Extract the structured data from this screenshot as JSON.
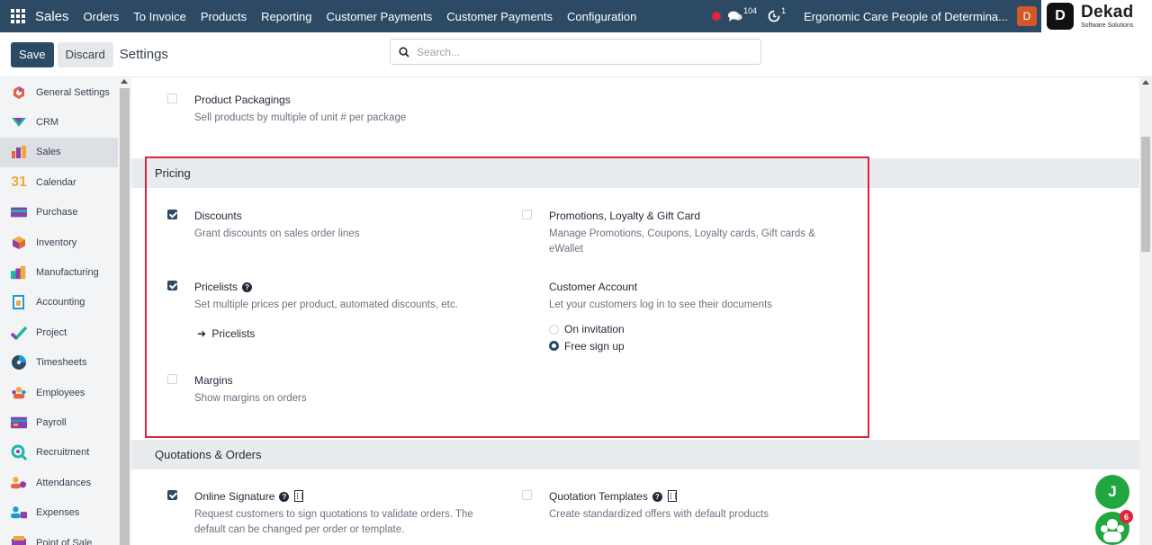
{
  "topbar": {
    "app_name": "Sales",
    "menu": [
      "Orders",
      "To Invoice",
      "Products",
      "Reporting",
      "Customer Payments",
      "Customer Payments",
      "Configuration"
    ],
    "messages_count": "104",
    "activities_count": "1",
    "company": "Ergonomic Care People of Determina...",
    "user_initial": "D",
    "brand_name": "Dekad",
    "brand_tagline": "Software Solutions",
    "brand_letter": "D"
  },
  "control_panel": {
    "save_label": "Save",
    "discard_label": "Discard",
    "title": "Settings",
    "search_placeholder": "Search..."
  },
  "sidebar": {
    "items": [
      {
        "label": "General Settings",
        "icon": "general-settings-icon"
      },
      {
        "label": "CRM",
        "icon": "crm-icon"
      },
      {
        "label": "Sales",
        "icon": "sales-icon",
        "active": true
      },
      {
        "label": "Calendar",
        "icon": "calendar-icon"
      },
      {
        "label": "Purchase",
        "icon": "purchase-icon"
      },
      {
        "label": "Inventory",
        "icon": "inventory-icon"
      },
      {
        "label": "Manufacturing",
        "icon": "manufacturing-icon"
      },
      {
        "label": "Accounting",
        "icon": "accounting-icon"
      },
      {
        "label": "Project",
        "icon": "project-icon"
      },
      {
        "label": "Timesheets",
        "icon": "timesheets-icon"
      },
      {
        "label": "Employees",
        "icon": "employees-icon"
      },
      {
        "label": "Payroll",
        "icon": "payroll-icon"
      },
      {
        "label": "Recruitment",
        "icon": "recruitment-icon"
      },
      {
        "label": "Attendances",
        "icon": "attendances-icon"
      },
      {
        "label": "Expenses",
        "icon": "expenses-icon"
      },
      {
        "label": "Point of Sale",
        "icon": "pos-icon"
      }
    ]
  },
  "settings": {
    "product_packagings": {
      "title": "Product Packagings",
      "desc": "Sell products by multiple of unit # per package",
      "checked": false
    },
    "pricing_section": "Pricing",
    "discounts": {
      "title": "Discounts",
      "desc": "Grant discounts on sales order lines",
      "checked": true
    },
    "promotions": {
      "title": "Promotions, Loyalty & Gift Card",
      "desc": "Manage Promotions, Coupons, Loyalty cards, Gift cards & eWallet",
      "checked": false
    },
    "pricelists": {
      "title": "Pricelists",
      "desc": "Set multiple prices per product, automated discounts, etc.",
      "checked": true,
      "link": "Pricelists"
    },
    "customer_account": {
      "title": "Customer Account",
      "desc": "Let your customers log in to see their documents",
      "options": [
        "On invitation",
        "Free sign up"
      ],
      "selected": "Free sign up"
    },
    "margins": {
      "title": "Margins",
      "desc": "Show margins on orders",
      "checked": false
    },
    "quotations_section": "Quotations & Orders",
    "online_signature": {
      "title": "Online Signature",
      "desc": "Request customers to sign quotations to validate orders. The default can be changed per order or template.",
      "checked": true
    },
    "quotation_templates": {
      "title": "Quotation Templates",
      "desc": "Create standardized offers with default products",
      "checked": false
    }
  },
  "floating": {
    "chat_initial": "J",
    "bot_badge": "6"
  },
  "colors": {
    "nav": "#2c4a63",
    "highlight": "#e0243d",
    "chat_green": "#22a640"
  }
}
